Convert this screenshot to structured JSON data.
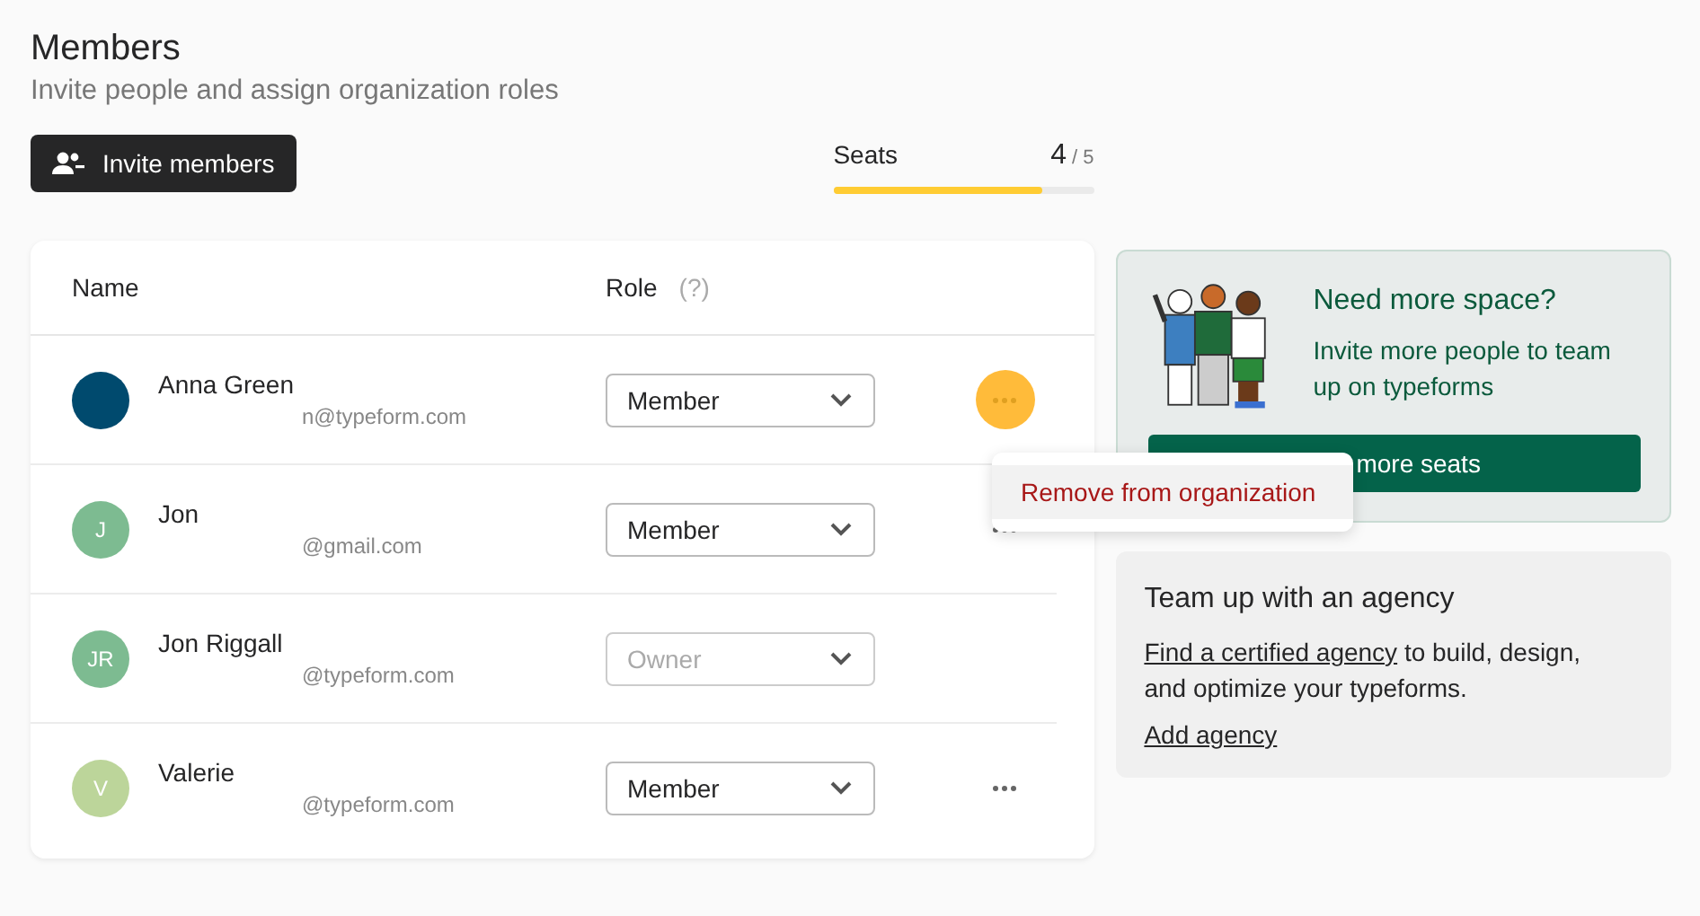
{
  "header": {
    "title": "Members",
    "subtitle": "Invite people and assign organization roles",
    "invite_button": "Invite members"
  },
  "seats": {
    "label": "Seats",
    "used": "4",
    "total": "/ 5",
    "level": 0.8
  },
  "table": {
    "columns": [
      "Name",
      "Role"
    ],
    "role_hint": "(?)",
    "rows": [
      {
        "name": "Anna Green",
        "email": "n@typeform.com",
        "initials": "",
        "color": "#004a6e",
        "role": "Member",
        "disabled": false,
        "actions": true,
        "menu_open": true
      },
      {
        "name": "Jon",
        "email": "@gmail.com",
        "initials": "J",
        "color": "#7dbb91",
        "role": "Member",
        "disabled": false,
        "actions": true,
        "menu_open": false
      },
      {
        "name": "Jon Riggall",
        "email": "@typeform.com",
        "initials": "JR",
        "color": "#7dbb91",
        "role": "Owner",
        "disabled": true,
        "actions": false
      },
      {
        "name": "Valerie",
        "email": "@typeform.com",
        "initials": "V",
        "color": "#bcd59a",
        "role": "Member",
        "disabled": false,
        "actions": true,
        "menu_open": false
      }
    ]
  },
  "row_menu": {
    "items": [
      "Remove from organization"
    ]
  },
  "upgrade_card": {
    "title": "Need more space?",
    "text": "Invite more people to team up on typeforms",
    "button": "more seats"
  },
  "agency_card": {
    "title": "Team up with an agency",
    "link": "Find a certified agency",
    "text": " to build, design, and optimize your typeforms.",
    "add_link": "Add agency"
  }
}
